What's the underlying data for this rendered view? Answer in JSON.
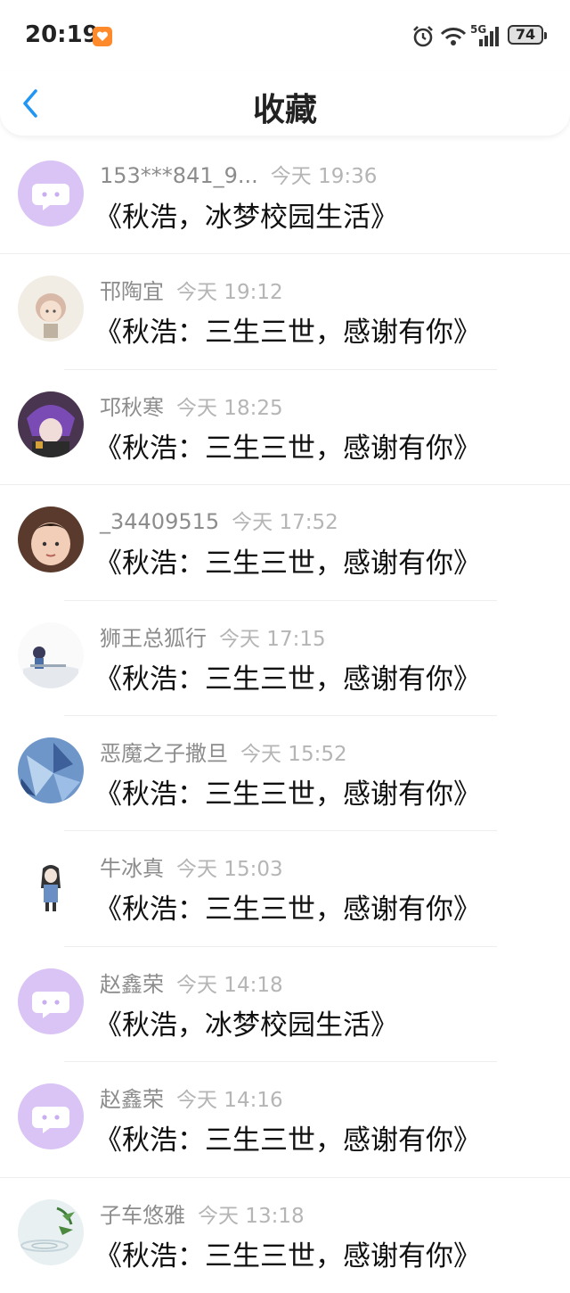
{
  "status_bar": {
    "time": "20:19",
    "network": "5G",
    "battery": "74"
  },
  "header": {
    "title": "收藏"
  },
  "items": [
    {
      "name": "153***841_9...",
      "date": "今天 19:36",
      "title": "《秋浩，冰梦校园生活》",
      "avatar": "default-chat-avatar"
    },
    {
      "name": "邗陶宜",
      "date": "今天 19:12",
      "title": "《秋浩：三生三世，感谢有你》",
      "avatar": "girl-avatar"
    },
    {
      "name": "邛秋寒",
      "date": "今天 18:25",
      "title": "《秋浩：三生三世，感谢有你》",
      "avatar": "purple-hair-avatar"
    },
    {
      "name": "_34409515",
      "date": "今天 17:52",
      "title": "《秋浩：三生三世，感谢有你》",
      "avatar": "child-photo-avatar"
    },
    {
      "name": "狮王总狐行",
      "date": "今天 17:15",
      "title": "《秋浩：三生三世，感谢有你》",
      "avatar": "anime-boy-avatar"
    },
    {
      "name": "恶魔之子撒旦",
      "date": "今天 15:52",
      "title": "《秋浩：三生三世，感谢有你》",
      "avatar": "blue-crystal-avatar"
    },
    {
      "name": "牛冰真",
      "date": "今天 15:03",
      "title": "《秋浩：三生三世，感谢有你》",
      "avatar": "sketch-girl-avatar"
    },
    {
      "name": "赵鑫荣",
      "date": "今天 14:18",
      "title": "《秋浩，冰梦校园生活》",
      "avatar": "default-chat-avatar"
    },
    {
      "name": "赵鑫荣",
      "date": "今天 14:16",
      "title": "《秋浩：三生三世，感谢有你》",
      "avatar": "default-chat-avatar"
    },
    {
      "name": "子车悠雅",
      "date": "今天 13:18",
      "title": "《秋浩：三生三世，感谢有你》",
      "avatar": "bamboo-water-avatar"
    }
  ],
  "colors": {
    "accent": "#2196f3",
    "default_avatar_bg": "#d9c4f5",
    "name_text": "#8c8c8c",
    "date_text": "#b5b5b5"
  }
}
